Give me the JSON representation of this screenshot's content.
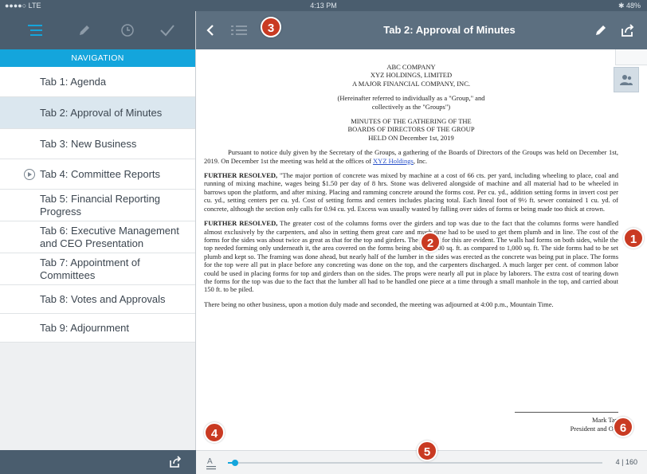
{
  "status_bar": {
    "carrier": "●●●●○ LTE",
    "time": "4:13 PM",
    "battery": "✱ 48%"
  },
  "left_toolbar": {
    "icons": [
      "list-icon",
      "pencil-icon",
      "clock-icon",
      "checkmark-icon"
    ]
  },
  "navigation": {
    "header": "NAVIGATION",
    "items": [
      {
        "label": "Tab 1: Agenda"
      },
      {
        "label": "Tab 2: Approval of Minutes"
      },
      {
        "label": "Tab 3: New Business"
      },
      {
        "label": "Tab 4: Committee Reports"
      },
      {
        "label": "Tab 5: Financial Reporting Progress"
      },
      {
        "label": "Tab 6: Executive Management and CEO Presentation"
      },
      {
        "label": "Tab 7: Appointment of Committees"
      },
      {
        "label": "Tab 8: Votes and Approvals"
      },
      {
        "label": "Tab 9: Adjournment"
      }
    ],
    "selected_index": 1
  },
  "main_toolbar": {
    "title": "Tab 2: Approval of Minutes"
  },
  "document": {
    "header_lines": [
      "ABC COMPANY",
      "XYZ HOLDINGS, LIMITED",
      "A MAJOR FINANCIAL COMPANY, INC."
    ],
    "ref_lines": [
      "(Hereinafter referred to individually as a \"Group,\" and",
      "collectively as the \"Groups\")"
    ],
    "minutes_lines": [
      "MINUTES OF THE GATHERING OF THE",
      "BOARDS OF DIRECTORS OF THE GROUP",
      "HELD ON December 1st, 2019"
    ],
    "intro": "Pursuant to notice duly given by the Secretary of the Groups, a gathering of the Boards of Directors of the Groups was held on December 1st, 2019. On December 1st the meeting was held at the offices of",
    "intro_link": "XYZ Holdings",
    "intro_end": ", Inc.",
    "para1_lead": "FURTHER RESOLVED,",
    "para1": " \"The major portion of concrete was mixed by machine at a cost of 66 cts. per yard, including wheeling to place, coal and running of mixing machine, wages being $1.50 per day of 8 hrs. Stone was delivered alongside of machine and all material had to be wheeled in barrows upon the platform, and after mixing. Placing and ramming concrete around the forms cost. Per cu. yd., addition setting forms in invert cost per cu. yd., setting centers per cu. yd. Cost of setting forms and centers includes placing total. Each lineal foot of 9½ ft. sewer contained 1 cu. yd. of concrete, although the section only calls for 0.94 cu. yd. Excess was usually wasted by falling over sides of forms or being made too thick at crown.",
    "para2_lead": "FURTHER RESOLVED,",
    "para2": " The greater cost of the columns forms over the girders and top was due to the fact that the columns forms were handled almost exclusively by the carpenters, and also in setting them great care and much time had to be used to get them plumb and in line. The cost of the forms for the sides was about twice as great as that for the top and girders. The reasons for this are evident. The walls had forms on both sides, while the top needed forming only underneath it, the area covered on the forms being about 2,200 sq. ft. as compared to 1,000 sq. ft. The side forms had to be set plumb and kept so. The framing was done ahead, but nearly half of the lumber in the sides was erected as the concrete was being put in place. The forms for the top were all put in place before any concreting was done on the top, and the carpenters discharged. A much larger per cent. of common labor could be used in placing forms for top and girders than on the sides. The props were nearly all put in place by laborers. The extra cost of tearing down the forms for the top was due to the fact that the lumber all had to be handled one piece at a time through a small manhole in the top, and carried about 150 ft. to be piled.",
    "closing": "There being no other business, upon a motion duly made and seconded, the meeting was adjourned at 4:00 p.m., Mountain Time.",
    "signature_name": "Mark Tay",
    "signature_title": "President and Ow"
  },
  "bottom_bar": {
    "page_count": "4 | 160",
    "progress_fraction": 0.019
  },
  "callouts": [
    "1",
    "2",
    "3",
    "4",
    "5",
    "6"
  ],
  "colors": {
    "toolbar": "#4a5d6e",
    "nav_header": "#14a5dc",
    "callout": "#c93a22",
    "selected": "#dbe7ef"
  }
}
